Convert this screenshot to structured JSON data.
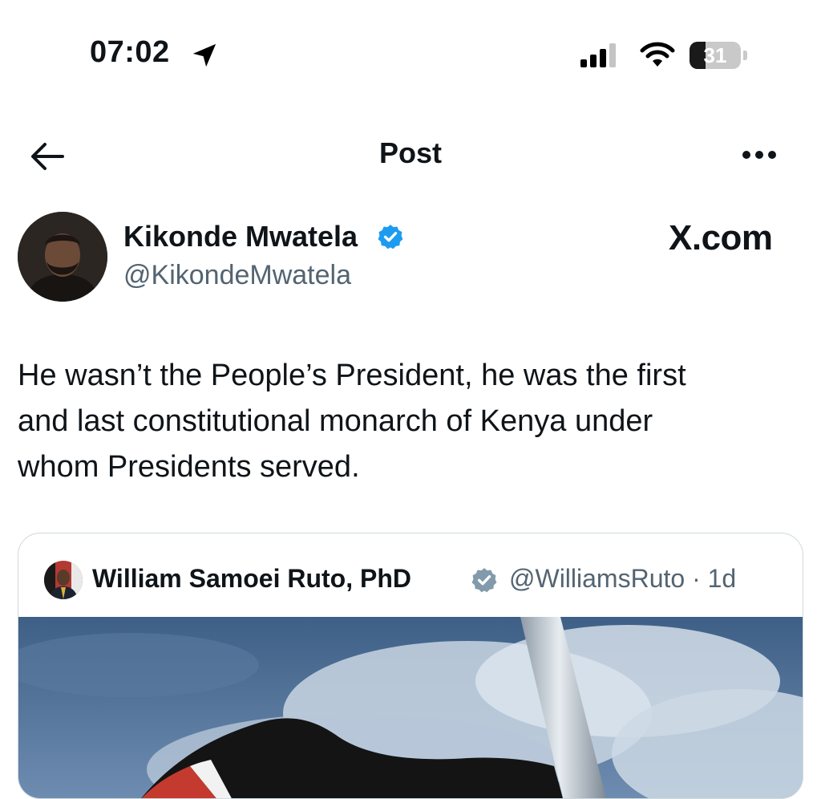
{
  "status_bar": {
    "time": "07:02",
    "battery": "31",
    "battery_level": 0.31,
    "icons": [
      "location-arrow-icon",
      "cellular-signal-icon",
      "wifi-icon",
      "battery-icon"
    ]
  },
  "header": {
    "title": "Post",
    "back_icon": "arrow-left-icon",
    "more_icon": "ellipsis-icon"
  },
  "author": {
    "name": "Kikonde Mwatela",
    "handle": "@KikondeMwatela",
    "verified_color": "#1d9bf0"
  },
  "watermark": "X.com",
  "post": {
    "text": "He wasn’t the People’s President, he was the first\nand last constitutional monarch of Kenya under\nwhom Presidents served."
  },
  "quoted_post": {
    "name": "William Samoei Ruto, PhD",
    "handle_time": "@WilliamsRuto · 1d",
    "verified_color": "#829aab"
  },
  "colors": {
    "text": "#0f1419",
    "secondary": "#536471",
    "border": "#cfd9de"
  }
}
